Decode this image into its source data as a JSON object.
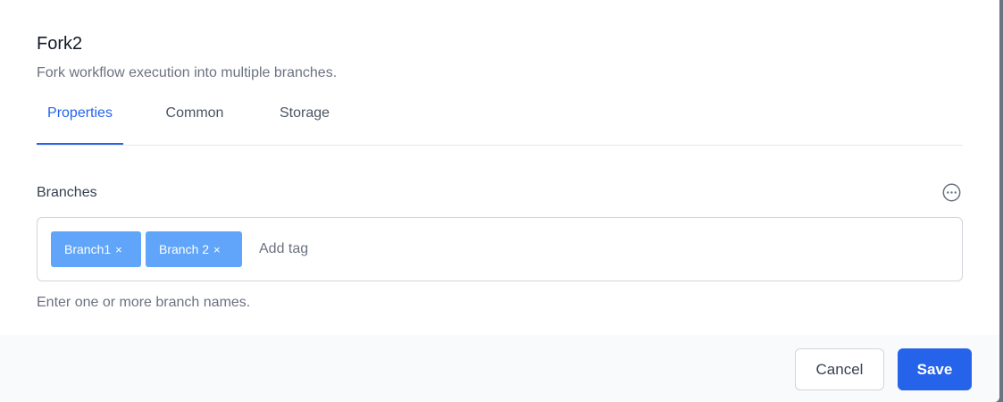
{
  "dialog": {
    "title": "Fork2",
    "subtitle": "Fork workflow execution into multiple branches."
  },
  "tabs": [
    {
      "label": "Properties",
      "active": true
    },
    {
      "label": "Common",
      "active": false
    },
    {
      "label": "Storage",
      "active": false
    }
  ],
  "branches": {
    "label": "Branches",
    "tags": [
      {
        "label": "Branch1",
        "remove": "×"
      },
      {
        "label": "Branch 2",
        "remove": "×"
      }
    ],
    "input_value": "",
    "placeholder": "Add tag",
    "helper": "Enter one or more branch names.",
    "more_icon": "ellipsis-circle-icon"
  },
  "footer": {
    "cancel_label": "Cancel",
    "save_label": "Save"
  },
  "colors": {
    "accent": "#2563eb",
    "tag_bg": "#60a5fa",
    "footer_bg": "#f9fafb"
  }
}
